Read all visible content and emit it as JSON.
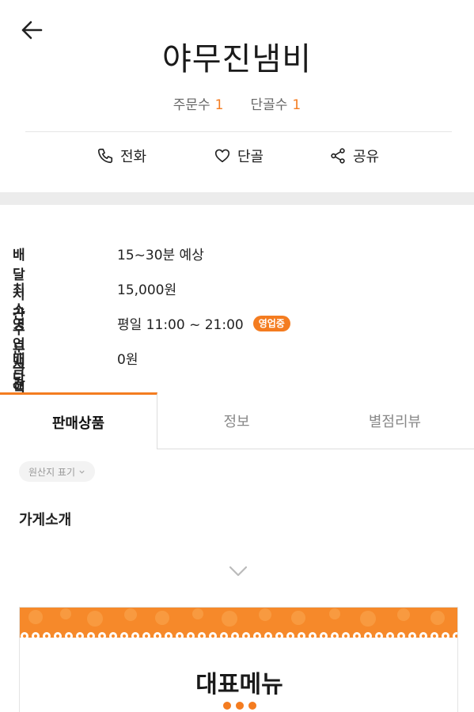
{
  "header": {
    "title": "야무진냄비",
    "back_icon": "arrow-left-icon"
  },
  "stats": {
    "orders_label": "주문수",
    "orders_count": "1",
    "regulars_label": "단골수",
    "regulars_count": "1"
  },
  "actions": {
    "call": "전화",
    "regular": "단골",
    "share": "공유"
  },
  "info": {
    "delivery_time_label": "배달시간",
    "delivery_time_value": "15~30분 예상",
    "min_order_label": "최소주문금액",
    "min_order_value": "15,000원",
    "hours_label": "영업시간",
    "hours_value": "평일 11:00 ~ 21:00",
    "open_badge": "영업중",
    "tip_label": "배달팁",
    "tip_value": "0원"
  },
  "tabs": [
    {
      "label": "판매상품",
      "active": true
    },
    {
      "label": "정보",
      "active": false
    },
    {
      "label": "별점리뷰",
      "active": false
    }
  ],
  "origin_chip": "원산지 표기",
  "intro_title": "가게소개",
  "banner": {
    "title": "대표메뉴"
  },
  "colors": {
    "accent": "#f47c20",
    "band": "#ececec"
  }
}
